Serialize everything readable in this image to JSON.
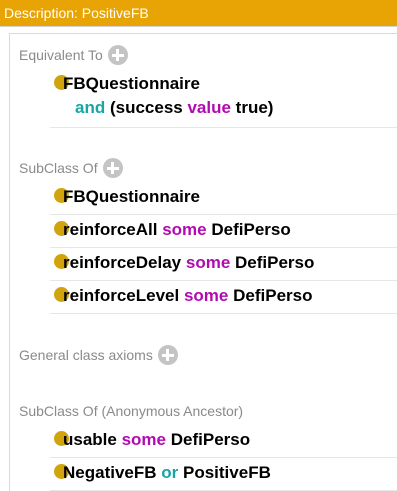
{
  "title": "Description: PositiveFB",
  "colors": {
    "title_bar": "#e8a404",
    "class_dot": "#d1a40e",
    "keyword_some_value": "#b10ab1",
    "keyword_and_or": "#17a5a5"
  },
  "sections": {
    "equivalent": {
      "label": "Equivalent To",
      "items": [
        {
          "line1": "FBQuestionnaire",
          "and": "and",
          "open": "(success ",
          "value": "value",
          "close": " true)"
        }
      ]
    },
    "subclass": {
      "label": "SubClass Of",
      "items": [
        {
          "name": "FBQuestionnaire"
        },
        {
          "name": "reinforceAll",
          "kw": "some",
          "target": "DefiPerso"
        },
        {
          "name": "reinforceDelay",
          "kw": "some",
          "target": "DefiPerso"
        },
        {
          "name": "reinforceLevel",
          "kw": "some",
          "target": "DefiPerso"
        }
      ]
    },
    "general": {
      "label": "General class axioms"
    },
    "ancestor": {
      "label": "SubClass Of (Anonymous Ancestor)",
      "items": [
        {
          "name": "usable",
          "kw": "some",
          "target": "DefiPerso"
        },
        {
          "name": "NegativeFB",
          "kw": "or",
          "target": "PositiveFB"
        }
      ]
    }
  },
  "icons": {
    "add": "plus-circle-icon",
    "class": "class-dot-icon"
  }
}
